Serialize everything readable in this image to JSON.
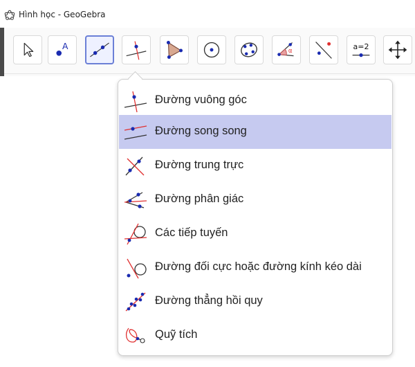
{
  "window": {
    "title": "Hình học - GeoGebra",
    "icon": "geogebra-logo-icon"
  },
  "toolbar": {
    "tools": [
      {
        "name": "move-tool",
        "icon": "cursor-arrow-icon"
      },
      {
        "name": "point-tool",
        "icon": "point-icon"
      },
      {
        "name": "line-tool",
        "icon": "line-through-two-points-icon",
        "selected": true
      },
      {
        "name": "perpendicular-line-tool",
        "icon": "perpendicular-line-icon"
      },
      {
        "name": "polygon-tool",
        "icon": "polygon-icon"
      },
      {
        "name": "circle-tool",
        "icon": "circle-center-point-icon"
      },
      {
        "name": "conic-tool",
        "icon": "conic-five-points-icon"
      },
      {
        "name": "angle-tool",
        "icon": "angle-icon",
        "label": "α"
      },
      {
        "name": "reflect-tool",
        "icon": "reflect-about-line-icon"
      },
      {
        "name": "slider-tool",
        "icon": "slider-icon",
        "label": "a=2"
      },
      {
        "name": "move-graphics-view-tool",
        "icon": "move-arrows-icon"
      }
    ]
  },
  "menu": {
    "items": [
      {
        "label": "Đường vuông góc",
        "icon": "perpendicular-line-icon"
      },
      {
        "label": "Đường song song",
        "icon": "parallel-line-icon",
        "active": true
      },
      {
        "label": "Đường trung trực",
        "icon": "perpendicular-bisector-icon"
      },
      {
        "label": "Đường phân giác",
        "icon": "angle-bisector-icon"
      },
      {
        "label": "Các tiếp tuyến",
        "icon": "tangents-icon"
      },
      {
        "label": "Đường đối cực hoặc đường kính kéo dài",
        "icon": "polar-diameter-line-icon"
      },
      {
        "label": "Đường thẳng hồi quy",
        "icon": "best-fit-line-icon"
      },
      {
        "label": "Quỹ tích",
        "icon": "locus-icon"
      }
    ]
  },
  "colors": {
    "accent_red": "#e03030",
    "point_blue": "#1a2bb0",
    "selected_border": "#6b7fd6",
    "menu_highlight": "#c6caf0"
  }
}
